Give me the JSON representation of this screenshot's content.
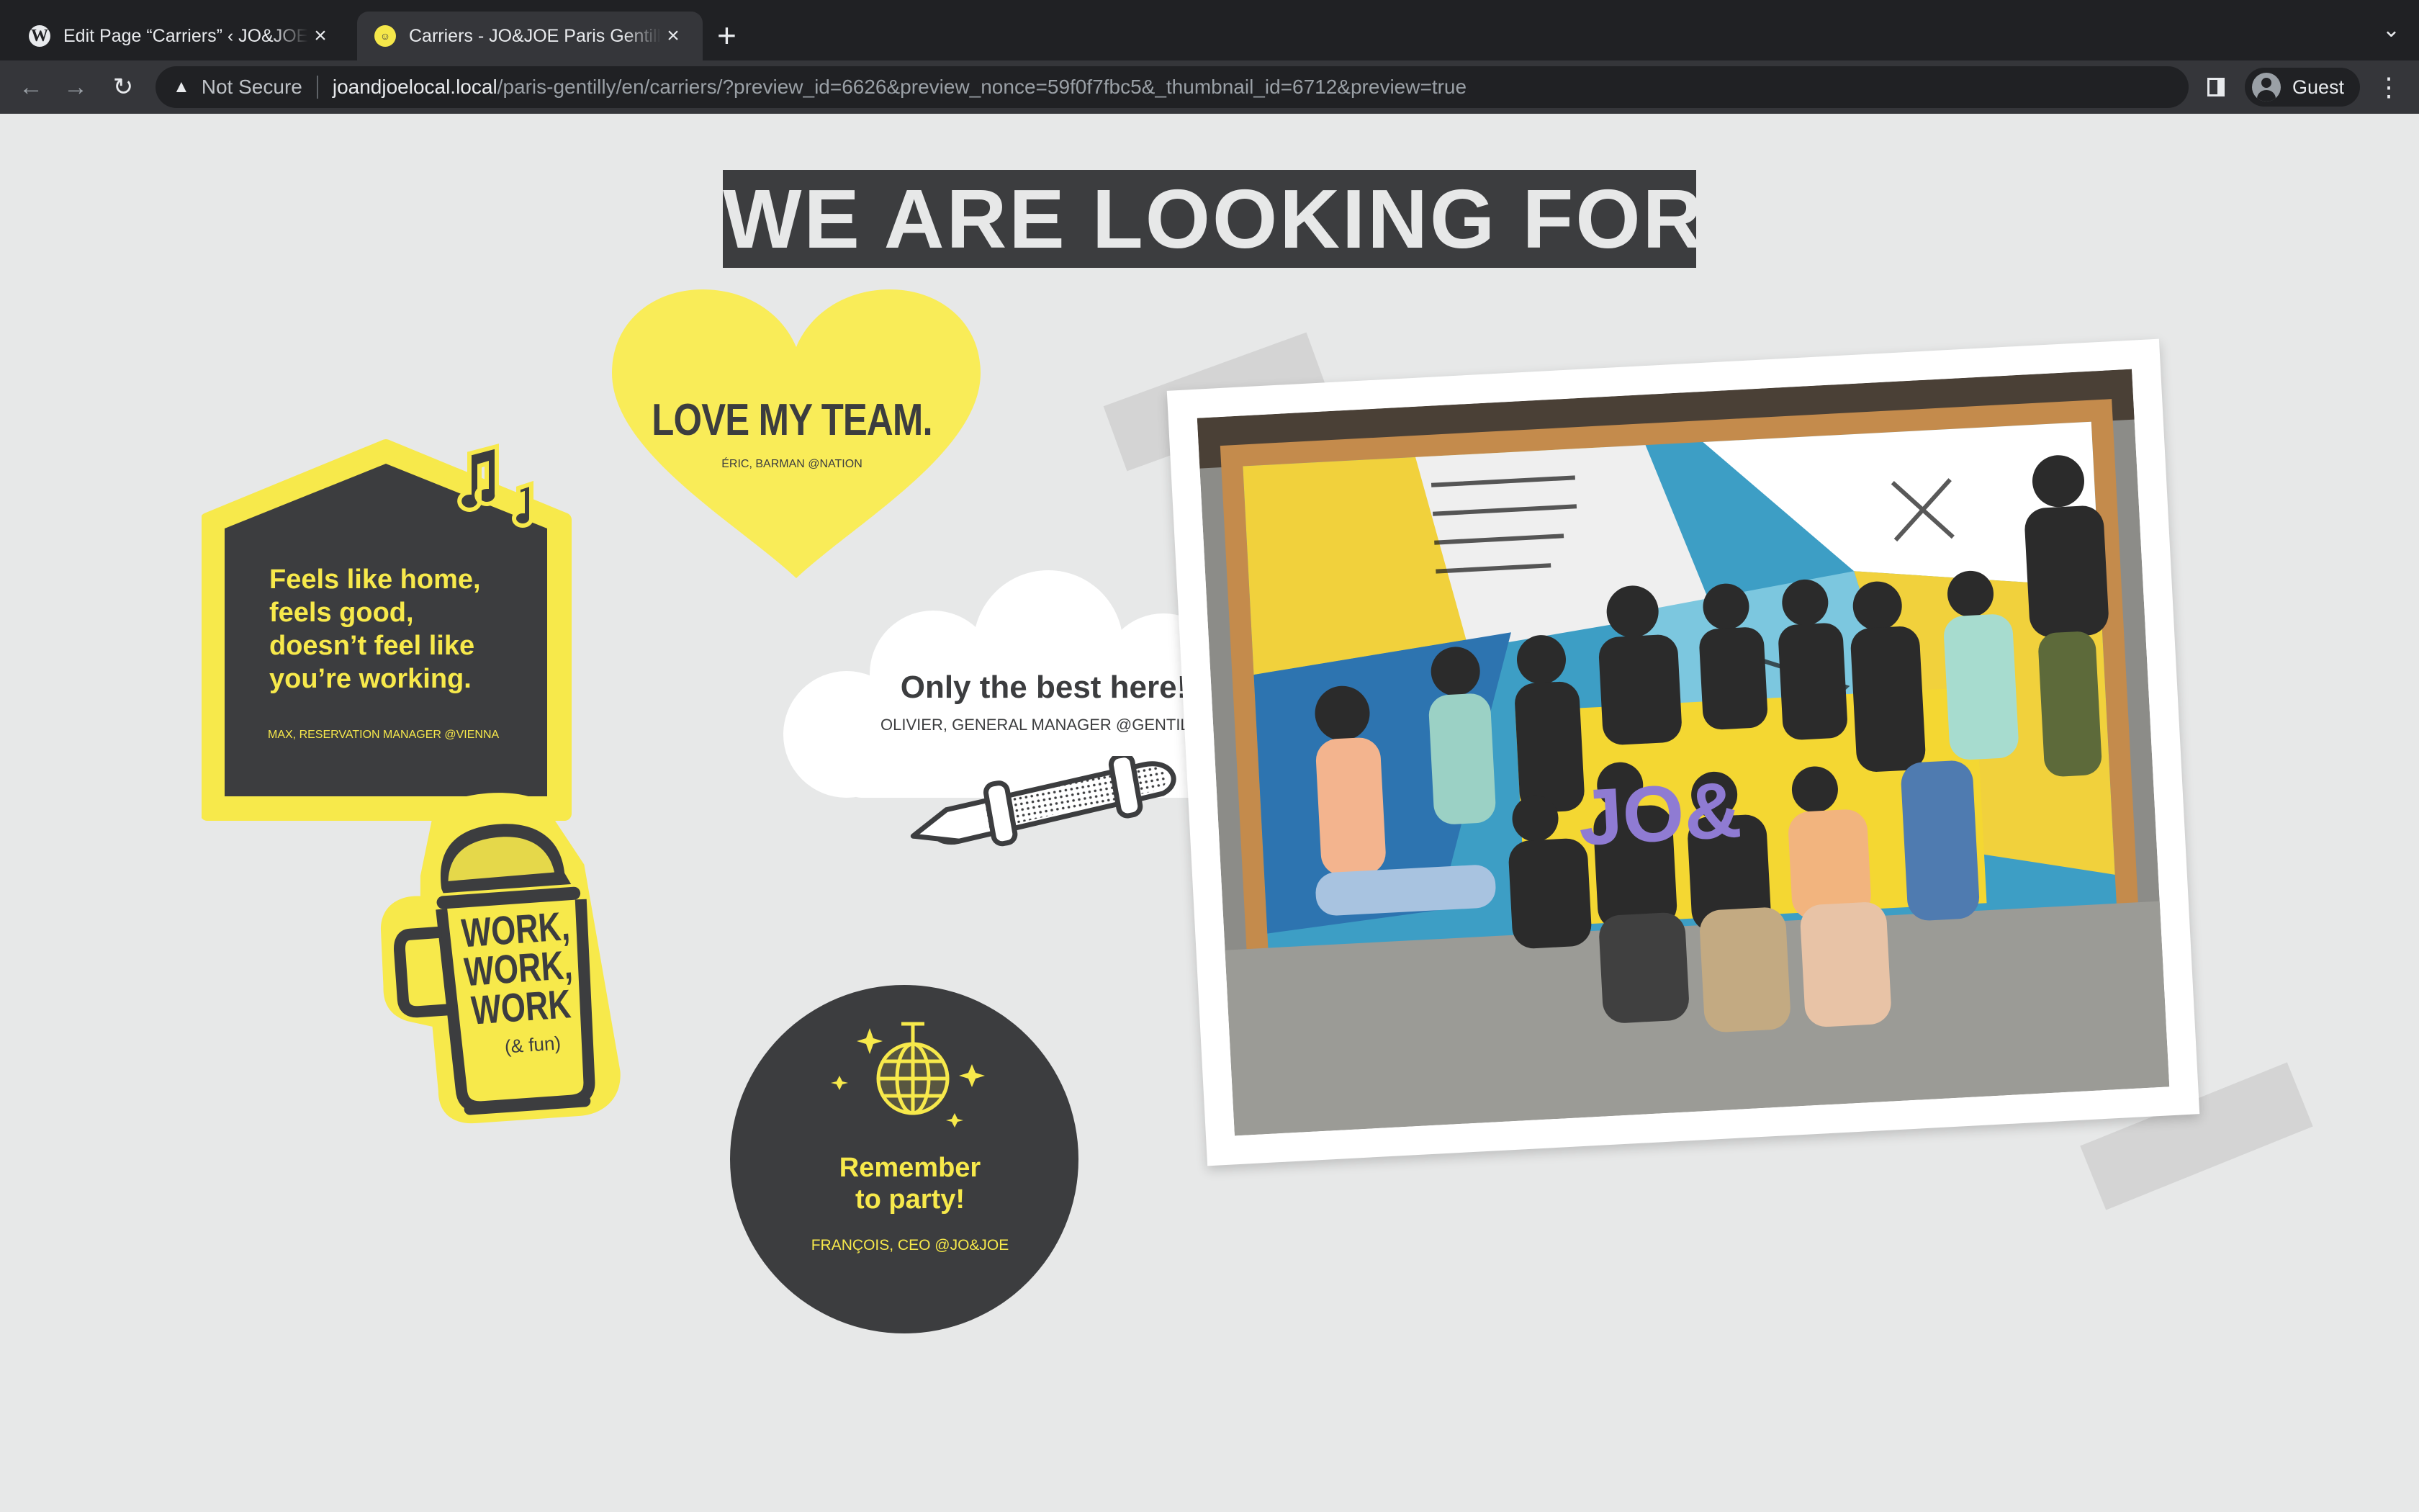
{
  "browser": {
    "tabs": [
      {
        "title": "Edit Page “Carriers” ‹ JO&JOE — WordPress",
        "favicon": "wordpress-icon",
        "active": false
      },
      {
        "title": "Carriers - JO&JOE Paris Gentilly",
        "favicon": "joandjoe-icon",
        "active": true
      }
    ],
    "new_tab": "+",
    "security_label": "Not Secure",
    "url_host": "joandjoelocal.local",
    "url_path": "/paris-gentilly/en/carriers/?preview_id=6626&preview_nonce=59f0f7fbc5&_thumbnail_id=6712&preview=true",
    "profile_name": "Guest"
  },
  "page": {
    "headline": "WE ARE LOOKING FOR...",
    "stickers": {
      "house": {
        "text_lines": [
          "Feels like home,",
          "feels good,",
          "doesn’t feel like",
          "you’re working."
        ],
        "caption": "MAX, RESERVATION MANAGER @VIENNA"
      },
      "heart": {
        "title": "LOVE MY TEAM.",
        "caption": "ÉRIC,  BARMAN @NATION"
      },
      "cloud": {
        "title": "Only the best here!",
        "caption": "OLIVIER, GENERAL MANAGER @GENTILLY"
      },
      "mug": {
        "lines": [
          "WORK,",
          "WORK,",
          "WORK"
        ],
        "fun": "(& fun)"
      },
      "party": {
        "title_lines": [
          "Remember",
          "to party!"
        ],
        "caption": "FRANÇOIS, CEO @JO&JOE"
      }
    },
    "photo": {
      "description": "team-photo",
      "banner_text": "JO&"
    }
  },
  "colors": {
    "yellow": "#f7e94b",
    "dark": "#3c3d3f",
    "background": "#e7e8e8"
  }
}
